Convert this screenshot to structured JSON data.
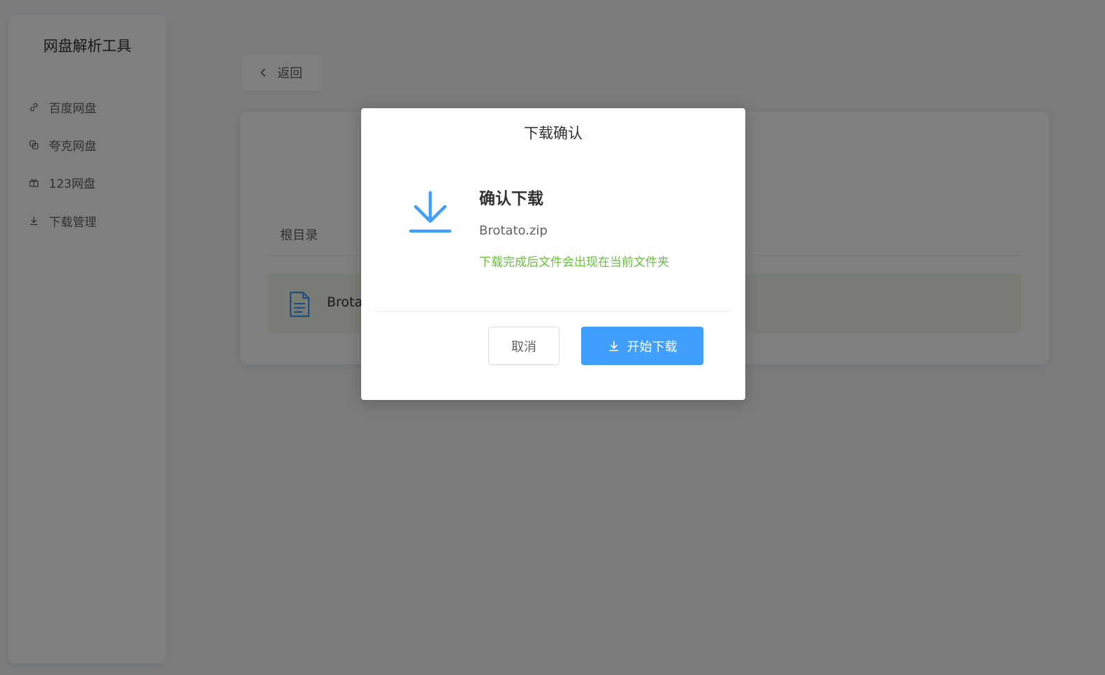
{
  "sidebar": {
    "title": "网盘解析工具",
    "items": [
      {
        "label": "百度网盘",
        "icon": "link-icon"
      },
      {
        "label": "夸克网盘",
        "icon": "copy-icon"
      },
      {
        "label": "123网盘",
        "icon": "gift-icon"
      },
      {
        "label": "下载管理",
        "icon": "download-icon"
      }
    ]
  },
  "header": {
    "back_label": "返回"
  },
  "main": {
    "breadcrumb": "根目录",
    "file_row": {
      "name": "Brotato.zip"
    }
  },
  "dialog": {
    "title": "下载确认",
    "heading": "确认下载",
    "filename": "Brotato.zip",
    "hint": "下载完成后文件会出现在当前文件夹",
    "cancel_label": "取消",
    "start_label": "开始下载"
  },
  "colors": {
    "primary": "#409eff",
    "success": "#67c23a",
    "text_primary": "#303133",
    "text_regular": "#606266",
    "row_highlight": "#f0f9eb"
  }
}
